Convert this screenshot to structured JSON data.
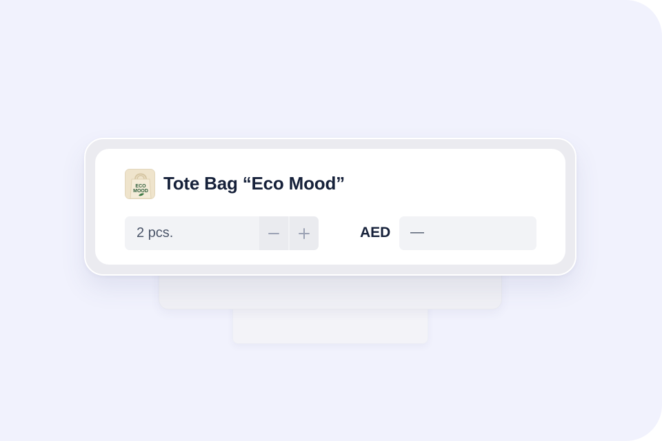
{
  "product": {
    "name": "Tote Bag “Eco Mood”",
    "thumbnail_text_line1": "ECO",
    "thumbnail_text_line2": "MOOD",
    "thumbnail_icon": "tote-bag-thumbnail"
  },
  "quantity": {
    "value": "2 pcs.",
    "decrement_icon": "minus-icon",
    "increment_icon": "plus-icon"
  },
  "price": {
    "currency": "AED",
    "value": "—"
  },
  "colors": {
    "background": "#f1f2fd",
    "card": "#ffffff",
    "title": "#16213a",
    "field": "#f2f3f6",
    "stepper": "#eaebef",
    "icon": "#9aa1b3"
  }
}
